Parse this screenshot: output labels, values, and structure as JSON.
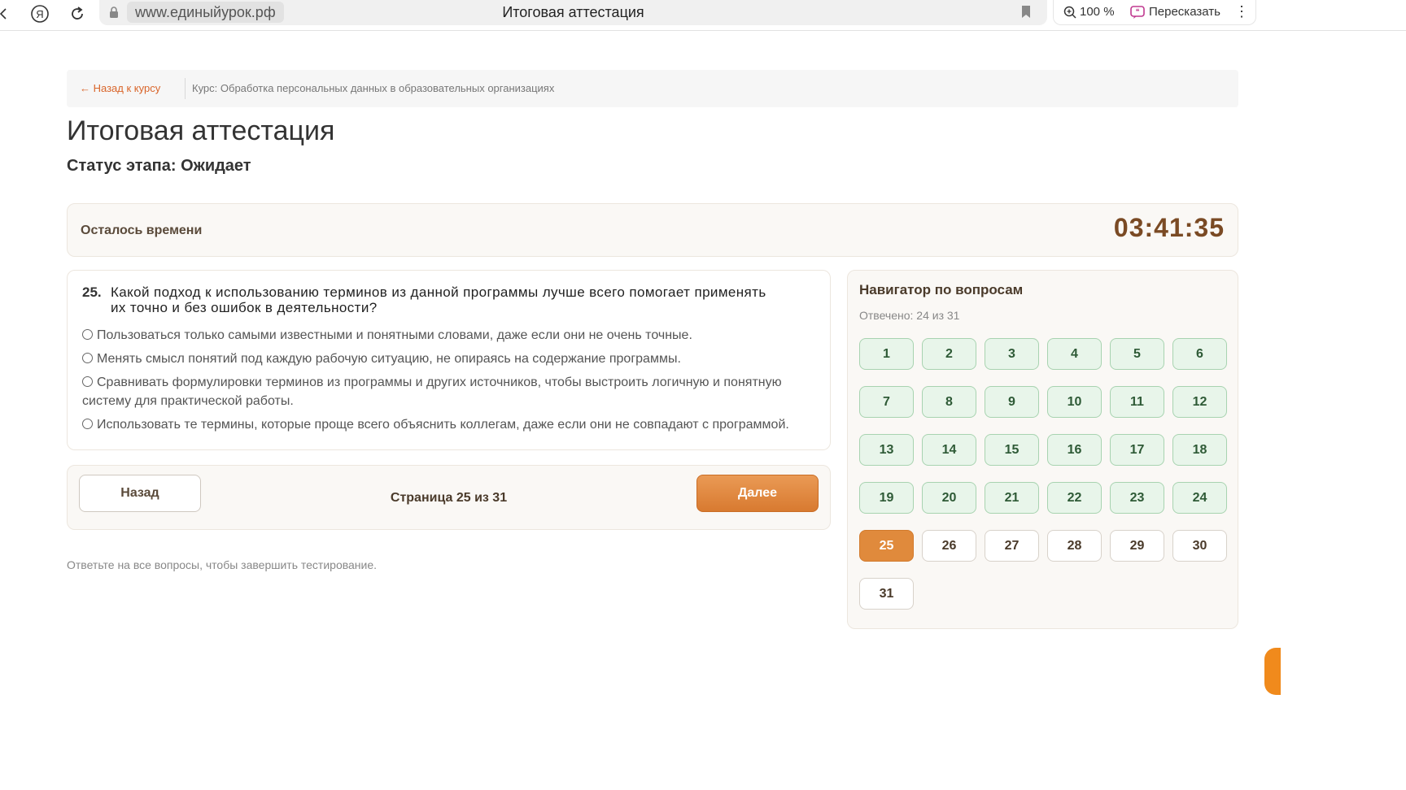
{
  "browser": {
    "url": "www.единыйурок.рф",
    "tab_title": "Итоговая аттестация",
    "zoom": "100 %",
    "retell_label": "Пересказать",
    "menu_glyph": "⋮",
    "ya_glyph": "Я"
  },
  "breadcrumb": {
    "back_label": "← Назад к курсу",
    "course": "Курс: Обработка персональных данных в образовательных организациях"
  },
  "page": {
    "title": "Итоговая аттестация",
    "status": "Статус этапа: Ожидает"
  },
  "timer": {
    "label": "Осталось времени",
    "value": "03:41:35"
  },
  "question": {
    "number": "25.",
    "text": "Какой подход к использованию терминов из данной программы лучше всего помогает применять их точно и без ошибок в деятельности?",
    "options": [
      "Пользоваться только самыми известными и понятными словами, даже если они не очень точные.",
      "Менять смысл понятий под каждую рабочую ситуацию, не опираясь на содержание программы.",
      "Сравнивать формулировки терминов из программы и других источников, чтобы выстроить логичную и понятную систему для практической работы.",
      "Использовать те термины, которые проще всего объяснить коллегам, даже если они не совпадают с программой."
    ]
  },
  "pagination": {
    "back_label": "Назад",
    "page_info": "Страница 25 из 31",
    "next_label": "Далее"
  },
  "hint": "Ответьте на все вопросы, чтобы завершить тестирование.",
  "navigator": {
    "title": "Навигатор по вопросам",
    "answered_text": "Отвечено: 24 из 31",
    "current": 25,
    "questions": [
      {
        "n": "1",
        "state": "answered"
      },
      {
        "n": "2",
        "state": "answered"
      },
      {
        "n": "3",
        "state": "answered"
      },
      {
        "n": "4",
        "state": "answered"
      },
      {
        "n": "5",
        "state": "answered"
      },
      {
        "n": "6",
        "state": "answered"
      },
      {
        "n": "7",
        "state": "answered"
      },
      {
        "n": "8",
        "state": "answered"
      },
      {
        "n": "9",
        "state": "answered"
      },
      {
        "n": "10",
        "state": "answered"
      },
      {
        "n": "11",
        "state": "answered"
      },
      {
        "n": "12",
        "state": "answered"
      },
      {
        "n": "13",
        "state": "answered"
      },
      {
        "n": "14",
        "state": "answered"
      },
      {
        "n": "15",
        "state": "answered"
      },
      {
        "n": "16",
        "state": "answered"
      },
      {
        "n": "17",
        "state": "answered"
      },
      {
        "n": "18",
        "state": "answered"
      },
      {
        "n": "19",
        "state": "answered"
      },
      {
        "n": "20",
        "state": "answered"
      },
      {
        "n": "21",
        "state": "answered"
      },
      {
        "n": "22",
        "state": "answered"
      },
      {
        "n": "23",
        "state": "answered"
      },
      {
        "n": "24",
        "state": "answered"
      },
      {
        "n": "25",
        "state": "current"
      },
      {
        "n": "26",
        "state": "empty"
      },
      {
        "n": "27",
        "state": "empty"
      },
      {
        "n": "28",
        "state": "empty"
      },
      {
        "n": "29",
        "state": "empty"
      },
      {
        "n": "30",
        "state": "empty"
      },
      {
        "n": "31",
        "state": "empty"
      }
    ]
  },
  "colors": {
    "accent_orange": "#e08a3c",
    "answered_green_bg": "#e8f5ea",
    "answered_green_border": "#a8d3b0",
    "timer_brown": "#7a4a24",
    "link_orange": "#d9652a"
  }
}
